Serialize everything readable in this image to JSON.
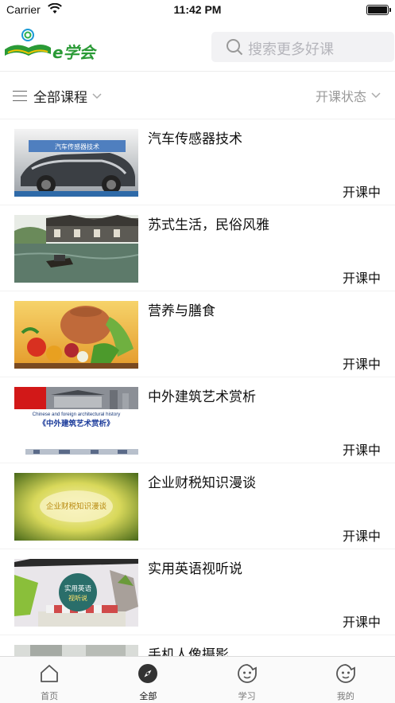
{
  "status_bar": {
    "carrier": "Carrier",
    "time": "11:42 PM"
  },
  "header": {
    "logo_text": "e学会",
    "search_placeholder": "搜索更多好课"
  },
  "filters": {
    "all_courses": "全部课程",
    "course_status": "开课状态"
  },
  "courses": [
    {
      "title": "汽车传感器技术",
      "status": "开课中",
      "thumb_caption": "汽车传感器技术"
    },
    {
      "title": "苏式生活，民俗风雅",
      "status": "开课中"
    },
    {
      "title": "营养与膳食",
      "status": "开课中"
    },
    {
      "title": "中外建筑艺术赏析",
      "status": "开课中",
      "thumb_caption_en": "Chinese and foreign architectural history",
      "thumb_caption": "《中外建筑艺术赏析》"
    },
    {
      "title": "企业财税知识漫谈",
      "status": "开课中",
      "thumb_caption": "企业财税知识漫谈"
    },
    {
      "title": "实用英语视听说",
      "status": "开课中",
      "thumb_caption": "实用英语",
      "thumb_caption2": "视听说"
    },
    {
      "title": "手机人像摄影",
      "status": ""
    }
  ],
  "tabs": [
    {
      "label": "首页",
      "icon": "home-icon"
    },
    {
      "label": "全部",
      "icon": "compass-icon",
      "active": true
    },
    {
      "label": "学习",
      "icon": "smiley-icon"
    },
    {
      "label": "我的",
      "icon": "smiley-icon"
    }
  ]
}
